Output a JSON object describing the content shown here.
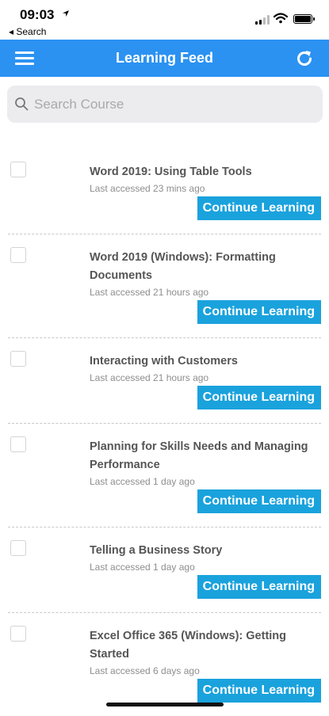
{
  "status_bar": {
    "time": "09:03",
    "back_label": "◂ Search"
  },
  "header": {
    "title": "Learning Feed",
    "color": "#2b92f2"
  },
  "search": {
    "placeholder": "Search Course",
    "value": ""
  },
  "feed": {
    "button_color": "#1aa2dd",
    "items": [
      {
        "title": "Word 2019: Using Table Tools",
        "last_accessed": "Last accessed 23 mins ago",
        "button": "Continue Learning"
      },
      {
        "title": "Word 2019 (Windows): Formatting Documents",
        "last_accessed": "Last accessed 21 hours ago",
        "button": "Continue Learning"
      },
      {
        "title": "Interacting with Customers",
        "last_accessed": "Last accessed 21 hours ago",
        "button": "Continue Learning"
      },
      {
        "title": "Planning for Skills Needs and Managing Performance",
        "last_accessed": "Last accessed 1 day ago",
        "button": "Continue Learning"
      },
      {
        "title": "Telling a Business Story",
        "last_accessed": "Last accessed 1 day ago",
        "button": "Continue Learning"
      },
      {
        "title": "Excel Office 365 (Windows): Getting Started",
        "last_accessed": "Last accessed 6 days ago",
        "button": "Continue Learning"
      }
    ]
  }
}
